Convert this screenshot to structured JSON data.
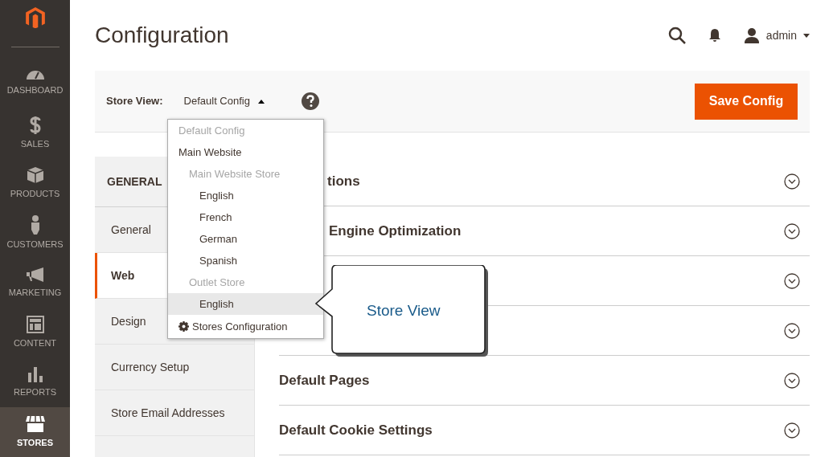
{
  "sidebar": {
    "items": [
      {
        "label": "DASHBOARD",
        "selected": false
      },
      {
        "label": "SALES",
        "selected": false
      },
      {
        "label": "PRODUCTS",
        "selected": false
      },
      {
        "label": "CUSTOMERS",
        "selected": false
      },
      {
        "label": "MARKETING",
        "selected": false
      },
      {
        "label": "CONTENT",
        "selected": false
      },
      {
        "label": "REPORTS",
        "selected": false
      },
      {
        "label": "STORES",
        "selected": true
      }
    ]
  },
  "header": {
    "title": "Configuration",
    "user": "admin"
  },
  "store_bar": {
    "label": "Store View:",
    "value": "Default Config",
    "save_button": "Save Config"
  },
  "dropdown": {
    "items": [
      {
        "label": "Default Config",
        "kind": "heading",
        "selected": false
      },
      {
        "label": "Main Website",
        "kind": "option",
        "selected": false,
        "children": [
          {
            "label": "Main Website Store",
            "kind": "heading",
            "selected": false,
            "children": [
              {
                "label": "English",
                "kind": "option",
                "selected": false
              },
              {
                "label": "French",
                "kind": "option",
                "selected": false
              },
              {
                "label": "German",
                "kind": "option",
                "selected": false
              },
              {
                "label": "Spanish",
                "kind": "option",
                "selected": false
              }
            ]
          },
          {
            "label": "Outlet Store",
            "kind": "heading",
            "selected": false,
            "children": [
              {
                "label": "English",
                "kind": "option",
                "selected": true
              }
            ]
          }
        ]
      }
    ],
    "footer": "Stores Configuration"
  },
  "callout": {
    "text": "Store View"
  },
  "config_nav": {
    "heading": "GENERAL",
    "items": [
      {
        "label": "General",
        "selected": false
      },
      {
        "label": "Web",
        "selected": true
      },
      {
        "label": "Design",
        "selected": false
      },
      {
        "label": "Currency Setup",
        "selected": false
      },
      {
        "label": "Store Email Addresses",
        "selected": false
      }
    ]
  },
  "sections": [
    {
      "title": "tions",
      "kind": "partial"
    },
    {
      "title": "Engine Optimization",
      "kind": "partial"
    },
    {
      "kind": "hidden"
    },
    {
      "kind": "hidden"
    },
    {
      "title": "Default Pages",
      "kind": "full"
    },
    {
      "title": "Default Cookie Settings",
      "kind": "full"
    }
  ]
}
